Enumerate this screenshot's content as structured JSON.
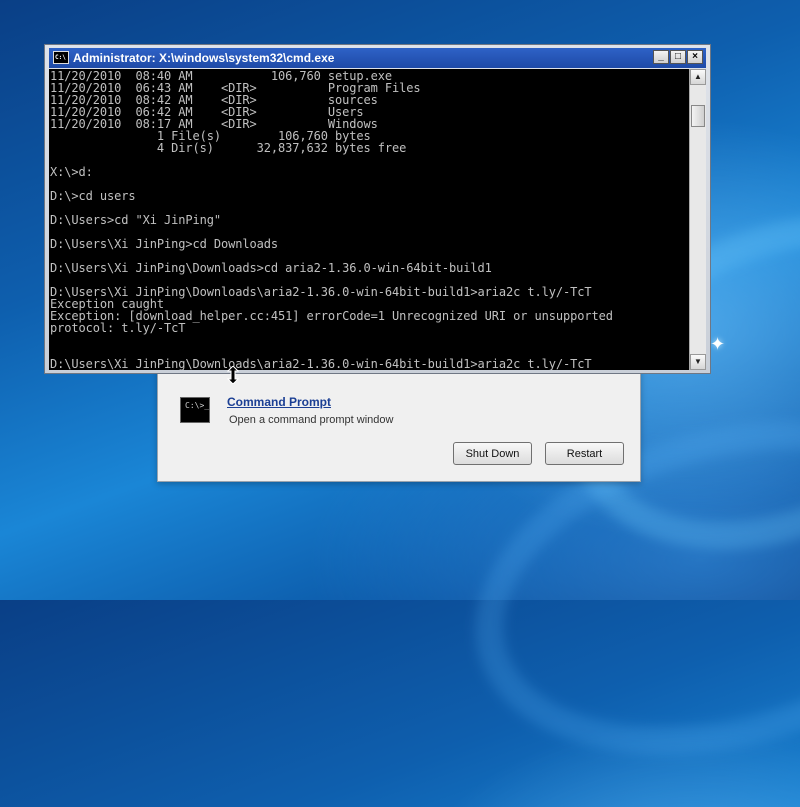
{
  "window": {
    "title": "Administrator: X:\\windows\\system32\\cmd.exe",
    "icon": "cmd-icon",
    "minimize_label": "_",
    "maximize_label": "□",
    "close_label": "×"
  },
  "console_lines": [
    "11/20/2010  08:40 AM           106,760 setup.exe",
    "11/20/2010  06:43 AM    <DIR>          Program Files",
    "11/20/2010  08:42 AM    <DIR>          sources",
    "11/20/2010  06:42 AM    <DIR>          Users",
    "11/20/2010  08:17 AM    <DIR>          Windows",
    "               1 File(s)        106,760 bytes",
    "               4 Dir(s)      32,837,632 bytes free",
    "",
    "X:\\>d:",
    "",
    "D:\\>cd users",
    "",
    "D:\\Users>cd \"Xi JinPing\"",
    "",
    "D:\\Users\\Xi JinPing>cd Downloads",
    "",
    "D:\\Users\\Xi JinPing\\Downloads>cd aria2-1.36.0-win-64bit-build1",
    "",
    "D:\\Users\\Xi JinPing\\Downloads\\aria2-1.36.0-win-64bit-build1>aria2c t.ly/-TcT",
    "Exception caught",
    "Exception: [download_helper.cc:451] errorCode=1 Unrecognized URI or unsupported",
    "protocol: t.ly/-TcT",
    "",
    "",
    "D:\\Users\\Xi JinPing\\Downloads\\aria2-1.36.0-win-64bit-build1>aria2c t.ly/-TcT"
  ],
  "recovery": {
    "command_prompt_title": "Command Prompt",
    "command_prompt_desc": "Open a command prompt window",
    "command_prompt_icon": "cmd-icon",
    "shutdown_label": "Shut Down",
    "restart_label": "Restart"
  },
  "colors": {
    "console_bg": "#000000",
    "console_fg": "#c0c0c0",
    "titlebar": "#2a5ac0",
    "link": "#1b3f94"
  }
}
